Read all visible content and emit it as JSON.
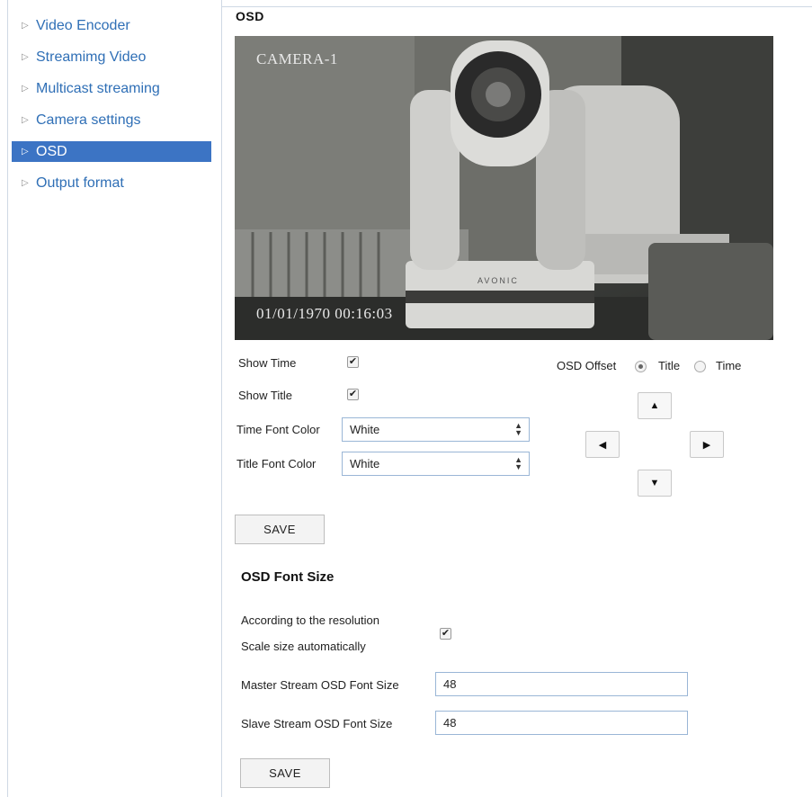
{
  "sidebar": {
    "items": [
      {
        "label": "Video Encoder"
      },
      {
        "label": "Streamimg Video"
      },
      {
        "label": "Multicast streaming"
      },
      {
        "label": "Camera settings"
      },
      {
        "label": "OSD"
      },
      {
        "label": "Output format"
      }
    ],
    "active_index": 4
  },
  "main": {
    "title": "OSD",
    "video": {
      "title_overlay": "CAMERA-1",
      "time_overlay": "01/01/1970 00:16:03",
      "brand_text": "AVONIC"
    },
    "show_time": {
      "label": "Show Time",
      "checked": true
    },
    "show_title": {
      "label": "Show Title",
      "checked": true
    },
    "time_font_color": {
      "label": "Time Font Color",
      "value": "White"
    },
    "title_font_color": {
      "label": "Title Font Color",
      "value": "White"
    },
    "osd_offset": {
      "label": "OSD Offset",
      "options": [
        {
          "label": "Title",
          "selected": true
        },
        {
          "label": "Time",
          "selected": false
        }
      ]
    },
    "arrows": {
      "up": "▲",
      "left": "◀",
      "right": "▶",
      "down": "▼"
    },
    "save_label": "SAVE"
  },
  "font_size": {
    "title": "OSD Font Size",
    "auto_line1": "According to the resolution",
    "auto_line2": "Scale size automatically",
    "auto_checked": true,
    "master": {
      "label": "Master Stream OSD Font Size",
      "value": "48"
    },
    "slave": {
      "label": "Slave Stream OSD Font Size",
      "value": "48"
    },
    "save_label": "SAVE"
  },
  "colors": {
    "accent": "#3c74c4",
    "link": "#2f6fb6"
  }
}
